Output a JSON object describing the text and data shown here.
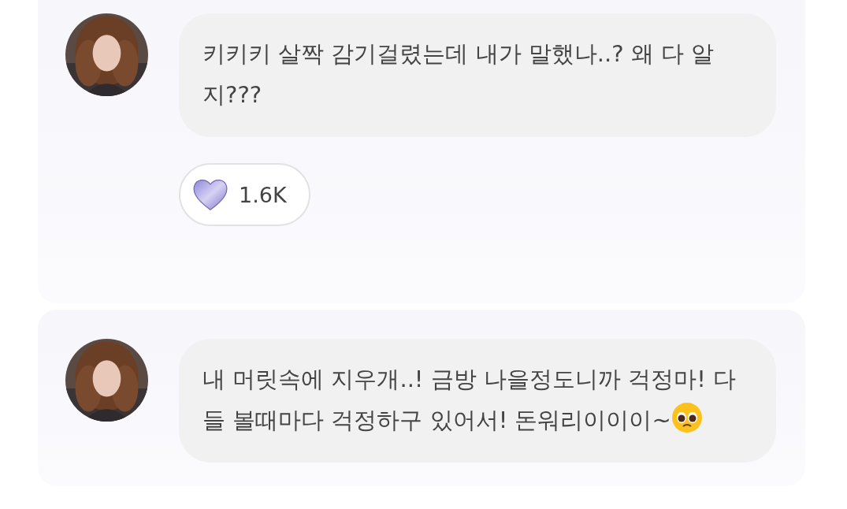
{
  "posts": [
    {
      "message": "키키키 살짝 감기걸렸는데 내가 말했나..? 왜 다 알지???",
      "ends_with_emoji": false,
      "reaction": {
        "count": "1.6K"
      }
    },
    {
      "message": "내 머릿속에 지우개..! 금방 나을정도니까 걱정마! 다들 볼때마다 걱정하구 있어서! 돈워리이이이~",
      "ends_with_emoji": true
    }
  ]
}
